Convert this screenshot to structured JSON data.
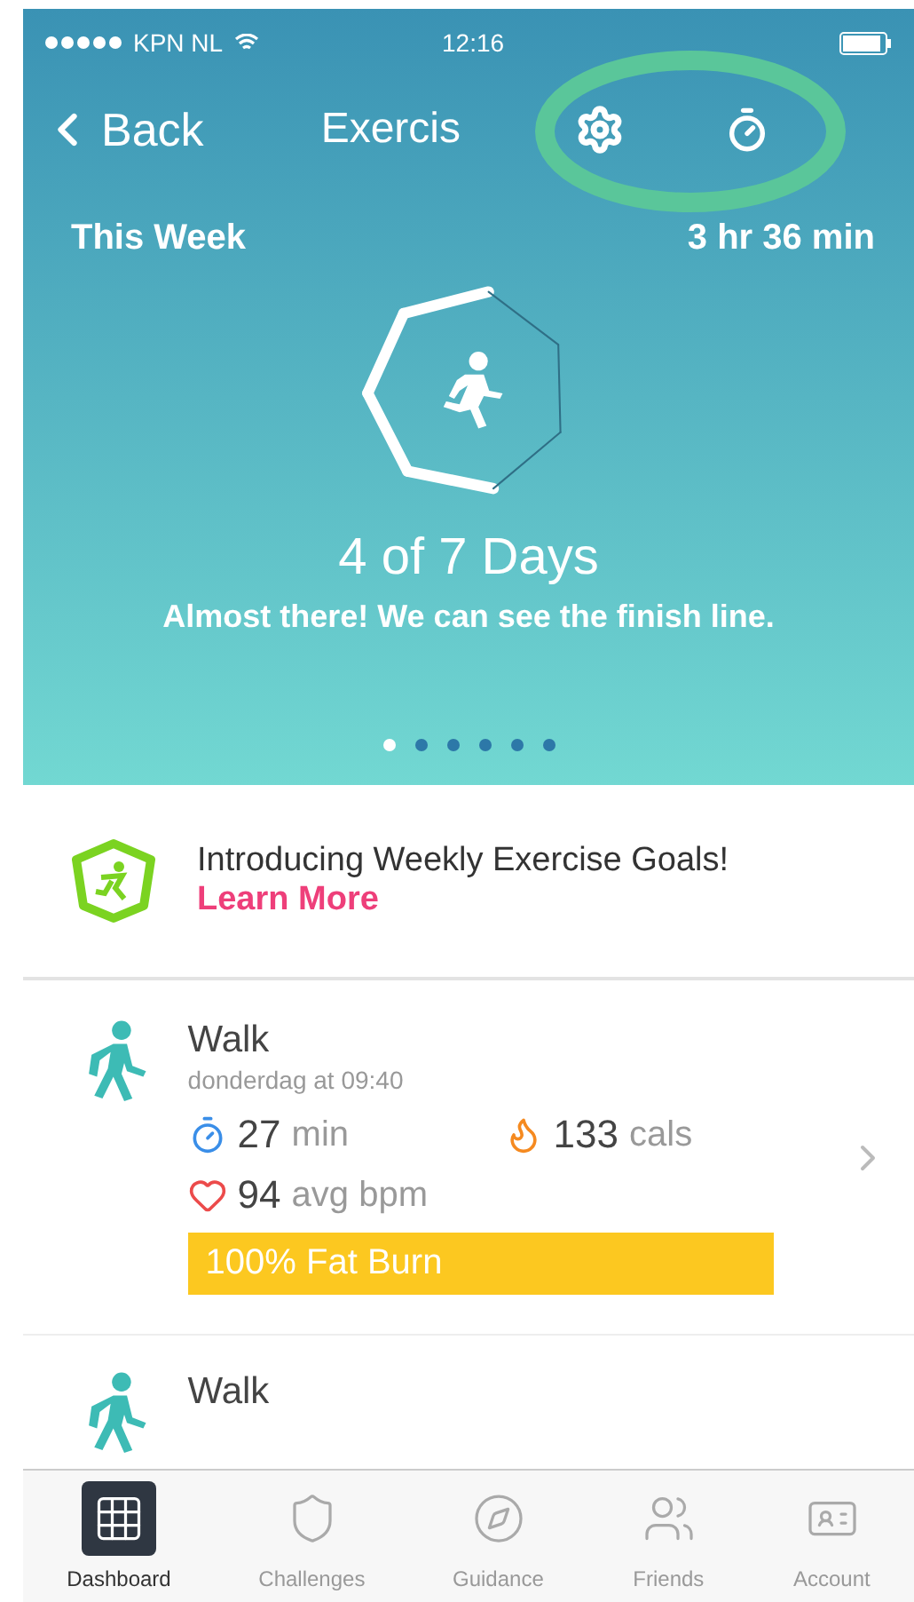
{
  "status_bar": {
    "carrier": "KPN NL",
    "time": "12:16"
  },
  "nav": {
    "back": "Back",
    "title": "Exercis"
  },
  "annotation": {
    "kind": "ellipse"
  },
  "summary": {
    "label": "This Week",
    "total": "3 hr 36 min",
    "ring_segments": [
      {
        "done": true
      },
      {
        "done": true
      },
      {
        "done": true
      },
      {
        "done": true
      },
      {
        "done": false
      },
      {
        "done": false
      },
      {
        "done": false
      }
    ],
    "days": "4 of 7 Days",
    "message": "Almost there! We can see the finish line."
  },
  "pager": [
    {
      "selected": true
    },
    {
      "selected": false
    },
    {
      "selected": false
    },
    {
      "selected": false
    },
    {
      "selected": false
    },
    {
      "selected": false
    }
  ],
  "promo": {
    "title": "Introducing Weekly Exercise Goals!",
    "link": "Learn More"
  },
  "activities": [
    {
      "name": "Walk",
      "time": "donderdag at 09:40",
      "stats": [
        {
          "kind": "duration",
          "value": "27",
          "unit": "min"
        },
        {
          "kind": "calories",
          "value": "133",
          "unit": "cals"
        },
        {
          "kind": "heart",
          "value": "94",
          "unit": "avg bpm"
        }
      ],
      "zone": "100% Fat Burn"
    },
    {
      "name": "Walk"
    }
  ],
  "tabs": [
    {
      "label": "Dashboard",
      "selected": true
    },
    {
      "label": "Challenges",
      "selected": false
    },
    {
      "label": "Guidance",
      "selected": false
    },
    {
      "label": "Friends",
      "selected": false
    },
    {
      "label": "Account",
      "selected": false
    }
  ]
}
